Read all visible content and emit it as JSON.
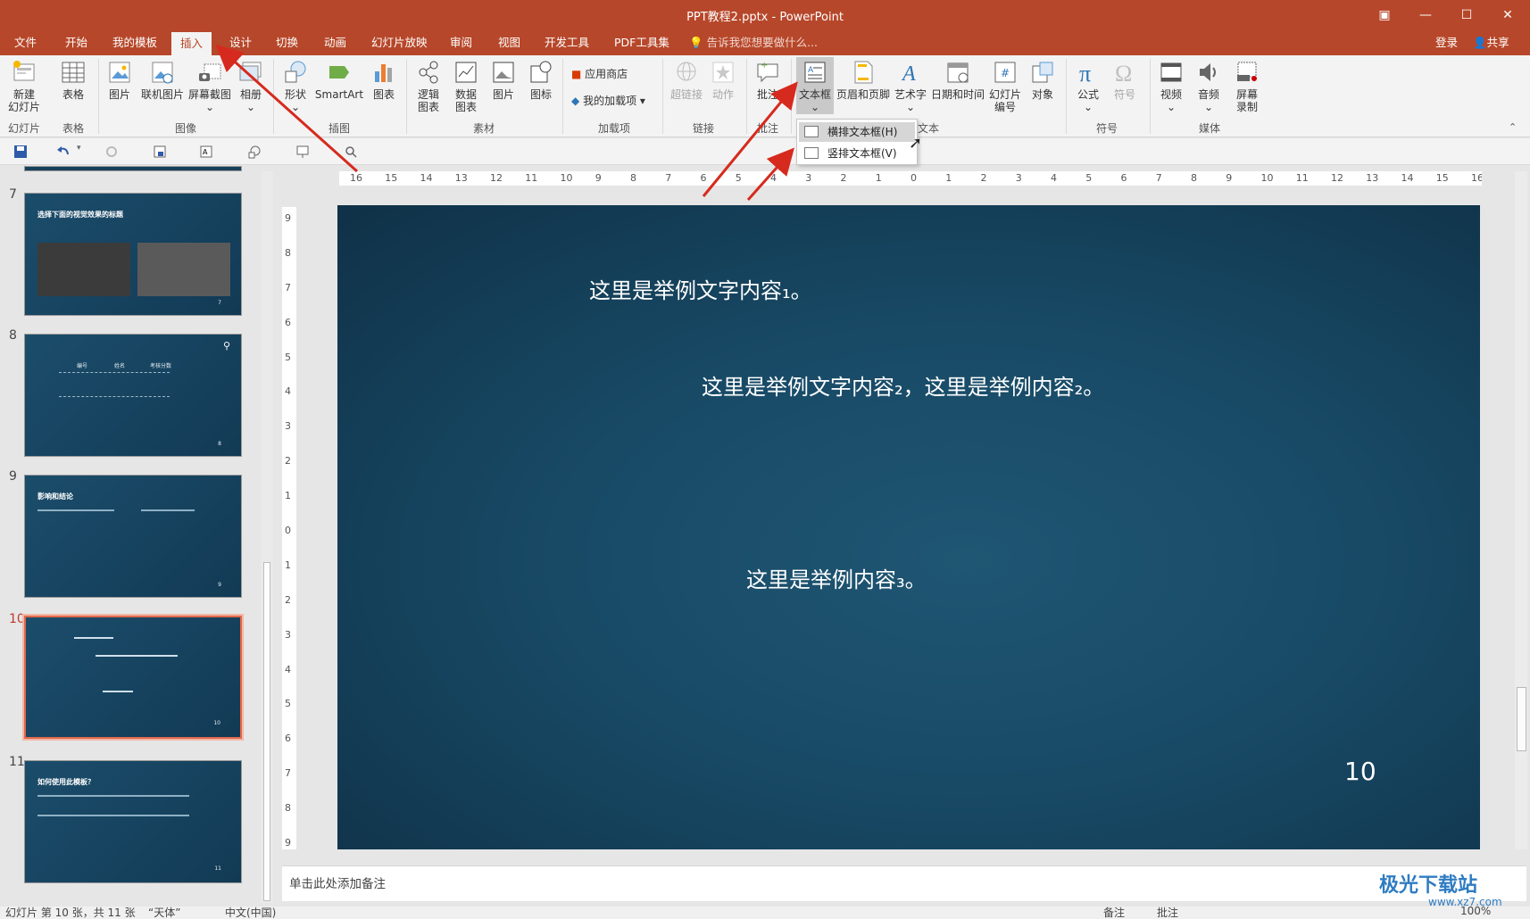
{
  "window": {
    "title": "PPT教程2.pptx - PowerPoint"
  },
  "menu": {
    "tabs": [
      "文件",
      "开始",
      "我的模板",
      "插入",
      "设计",
      "切换",
      "动画",
      "幻灯片放映",
      "审阅",
      "视图",
      "开发工具",
      "PDF工具集"
    ],
    "active_tab": "插入",
    "tell_me": "告诉我您想要做什么...",
    "login": "登录",
    "share": "共享"
  },
  "ribbon": {
    "new_slide": "新建\n幻灯片",
    "table": "表格",
    "picture": "图片",
    "online_picture": "联机图片",
    "screenshot": "屏幕截图",
    "album": "相册",
    "shapes": "形状",
    "smartart": "SmartArt",
    "chart": "图表",
    "logic_chart": "逻辑\n图表",
    "data_chart": "数据\n图表",
    "material_picture": "图片",
    "icon": "图标",
    "app_store": "应用商店",
    "my_addins": "我的加载项",
    "hyperlink": "超链接",
    "action": "动作",
    "comment": "批注",
    "textbox": "文本框",
    "header_footer": "页眉和页脚",
    "wordart": "艺术字",
    "datetime": "日期和时间",
    "slide_number": "幻灯片\n编号",
    "object": "对象",
    "equation": "公式",
    "symbol": "符号",
    "video": "视频",
    "audio": "音频",
    "screen_record": "屏幕\n录制",
    "groups": {
      "slides": "幻灯片",
      "tables": "表格",
      "images": "图像",
      "illustrations": "插图",
      "material": "素材",
      "addins": "加载项",
      "links": "链接",
      "comments": "批注",
      "text": "文本",
      "symbols": "符号",
      "media": "媒体"
    }
  },
  "dropdown": {
    "horizontal": "横排文本框(H)",
    "vertical": "竖排文本框(V)"
  },
  "thumbnails": [
    {
      "num": "7",
      "title": "选择下面的视觉效果的标题",
      "page": "7"
    },
    {
      "num": "8",
      "page": "8",
      "headers": [
        "编号",
        "姓名",
        "考核分数"
      ]
    },
    {
      "num": "9",
      "title": "影响和结论",
      "page": "9"
    },
    {
      "num": "10",
      "page": "10"
    },
    {
      "num": "11",
      "title": "如何使用此模板？",
      "page": "11"
    }
  ],
  "slide": {
    "text1": "这里是举例文字内容₁。",
    "text2": "这里是举例文字内容₂，这里是举例内容₂。",
    "text3": "这里是举例内容₃。",
    "page": "10"
  },
  "ruler": {
    "h_ticks": [
      "16",
      "15",
      "14",
      "13",
      "12",
      "11",
      "10",
      "9",
      "8",
      "7",
      "6",
      "5",
      "4",
      "3",
      "2",
      "1",
      "0",
      "1",
      "2",
      "3",
      "4",
      "5",
      "6",
      "7",
      "8",
      "9",
      "10",
      "11",
      "12",
      "13",
      "14",
      "15",
      "16"
    ],
    "v_ticks": [
      "9",
      "8",
      "7",
      "6",
      "5",
      "4",
      "3",
      "2",
      "1",
      "0",
      "1",
      "2",
      "3",
      "4",
      "5",
      "6",
      "7",
      "8",
      "9"
    ]
  },
  "notes": {
    "placeholder": "单击此处添加备注"
  },
  "status": {
    "slide_info": "幻灯片 第 10 张，共 11 张",
    "theme": "“天体”",
    "language": "中文(中国)",
    "notes_btn": "备注",
    "comments_btn": "批注",
    "zoom": "100%"
  },
  "watermark": {
    "brand": "极光下载站",
    "url": "www.xz7.com"
  }
}
